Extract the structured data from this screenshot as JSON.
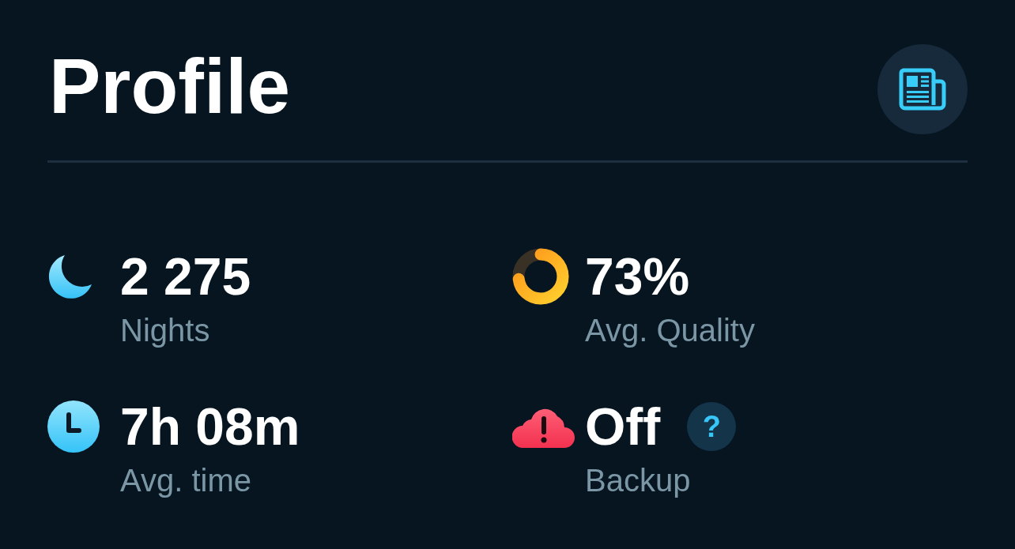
{
  "header": {
    "title": "Profile"
  },
  "stats": [
    {
      "kind": "moon",
      "value": "2 275",
      "label": "Nights"
    },
    {
      "kind": "ring",
      "value": "73%",
      "label": "Avg. Quality",
      "level": 0.73
    },
    {
      "kind": "clock",
      "value": "7h 08m",
      "label": "Avg. time"
    },
    {
      "kind": "alert",
      "value": "Off",
      "label": "Backup",
      "help": "?"
    }
  ]
}
